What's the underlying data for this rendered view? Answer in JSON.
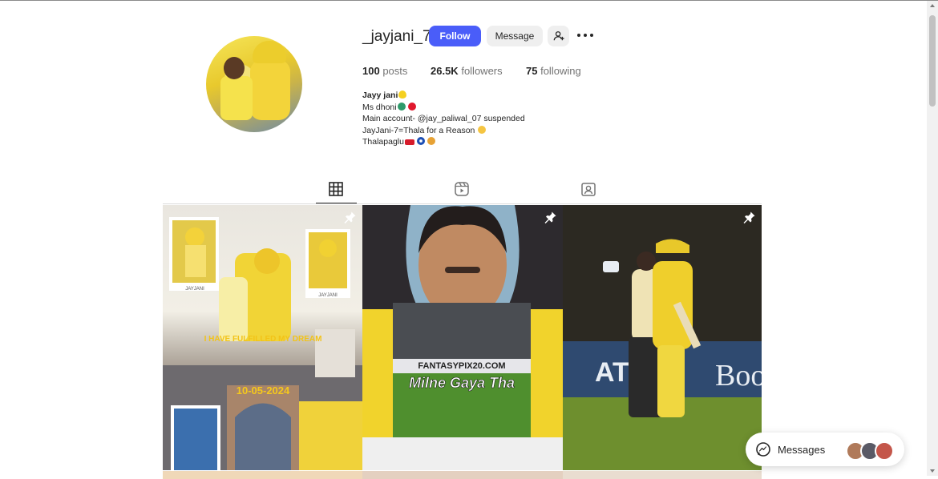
{
  "profile": {
    "username": "_jayjani_7",
    "follow_label": "Follow",
    "message_label": "Message",
    "stats": {
      "posts_count": "100",
      "posts_label": "posts",
      "followers_count": "26.5K",
      "followers_label": "followers",
      "following_count": "75",
      "following_label": "following"
    },
    "bio": {
      "name": "Jayy jani",
      "line1": "Ms dhoni",
      "line2": "Main account- @jay_paliwal_07 suspended",
      "line3": "JayJani-7=Thala for a Reason",
      "line4": "Thalapaglu"
    }
  },
  "tabs": [
    {
      "icon": "grid-icon",
      "active": true
    },
    {
      "icon": "reels-icon",
      "active": false
    },
    {
      "icon": "tagged-icon",
      "active": false
    }
  ],
  "posts": [
    {
      "pinned": true,
      "overlay_text": "I HAVE FULFILLED MY DREAM",
      "date_text": "10-05-2024",
      "tags": [
        "JAYJANI",
        "JAYJANI"
      ]
    },
    {
      "pinned": true,
      "caption": "Milne Gaya Tha",
      "board_text": "FANTASYPIX20.COM"
    },
    {
      "pinned": true,
      "board_text": "AT",
      "board_text2": "Boo"
    }
  ],
  "messages": {
    "label": "Messages"
  },
  "colors": {
    "follow_button": "#4a5df9",
    "accent_yellow": "#f5d938"
  }
}
